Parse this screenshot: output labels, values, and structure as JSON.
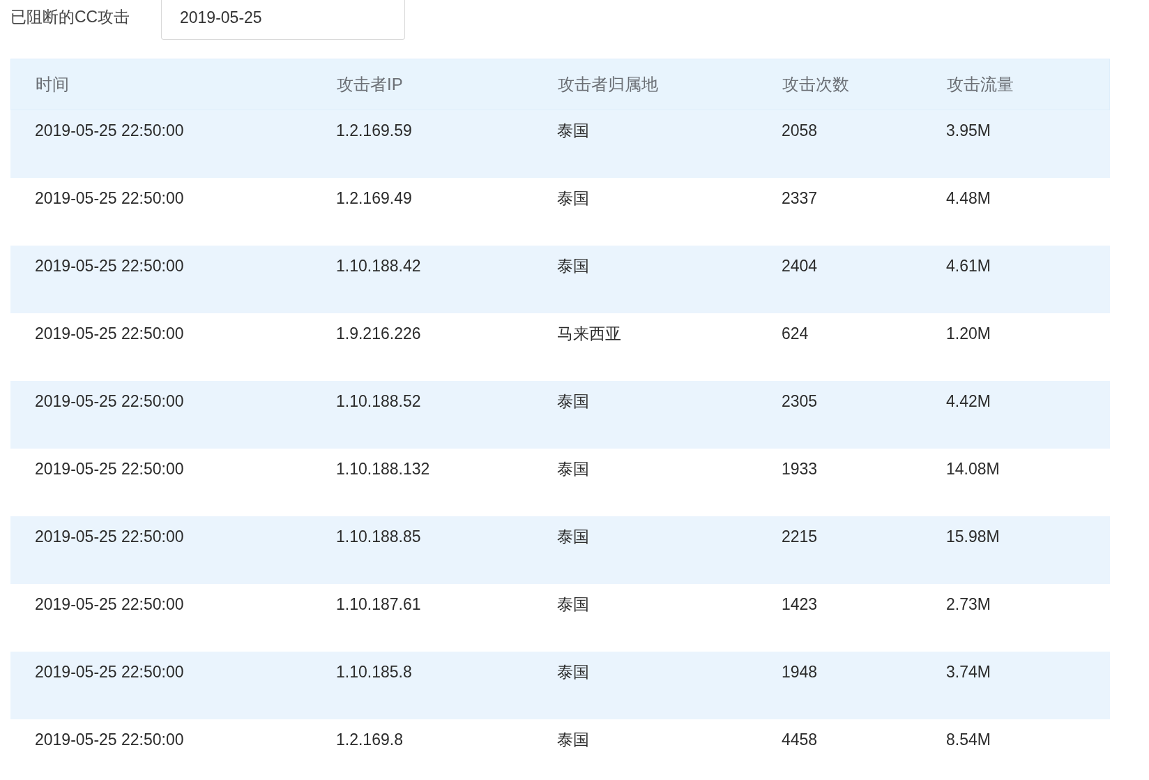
{
  "filter": {
    "label": "已阻断的CC攻击",
    "date": "2019-05-25"
  },
  "table": {
    "columns": [
      "时间",
      "攻击者IP",
      "攻击者归属地",
      "攻击次数",
      "攻击流量"
    ],
    "rows": [
      [
        "2019-05-25 22:50:00",
        "1.2.169.59",
        "泰国",
        "2058",
        "3.95M"
      ],
      [
        "2019-05-25 22:50:00",
        "1.2.169.49",
        "泰国",
        "2337",
        "4.48M"
      ],
      [
        "2019-05-25 22:50:00",
        "1.10.188.42",
        "泰国",
        "2404",
        "4.61M"
      ],
      [
        "2019-05-25 22:50:00",
        "1.9.216.226",
        "马来西亚",
        "624",
        "1.20M"
      ],
      [
        "2019-05-25 22:50:00",
        "1.10.188.52",
        "泰国",
        "2305",
        "4.42M"
      ],
      [
        "2019-05-25 22:50:00",
        "1.10.188.132",
        "泰国",
        "1933",
        "14.08M"
      ],
      [
        "2019-05-25 22:50:00",
        "1.10.188.85",
        "泰国",
        "2215",
        "15.98M"
      ],
      [
        "2019-05-25 22:50:00",
        "1.10.187.61",
        "泰国",
        "1423",
        "2.73M"
      ],
      [
        "2019-05-25 22:50:00",
        "1.10.185.8",
        "泰国",
        "1948",
        "3.74M"
      ],
      [
        "2019-05-25 22:50:00",
        "1.2.169.8",
        "泰国",
        "4458",
        "8.54M"
      ]
    ]
  }
}
